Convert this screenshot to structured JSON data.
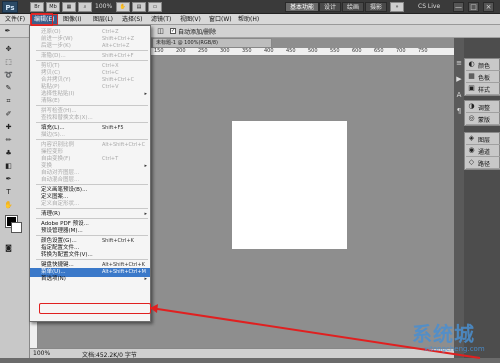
{
  "appbar": {
    "logo": "Ps",
    "zoom": "100%",
    "workspaces": [
      "基本功能",
      "设计",
      "绘画",
      "摄影"
    ],
    "cs_live": "CS Live",
    "window_controls": [
      "—",
      "□",
      "×"
    ]
  },
  "menubar": {
    "items": [
      "文件(F)",
      "编辑(E)",
      "图像(I)",
      "图层(L)",
      "选择(S)",
      "滤镜(T)",
      "视图(V)",
      "窗口(W)",
      "帮助(H)"
    ],
    "selected_index": 1
  },
  "options": {
    "auto_add_delete": "自动添加/删除"
  },
  "edit_menu": [
    {
      "label": "还原(O)",
      "shortcut": "Ctrl+Z",
      "disabled": true
    },
    {
      "label": "前进一步(W)",
      "shortcut": "Shift+Ctrl+Z",
      "disabled": true
    },
    {
      "label": "后退一步(K)",
      "shortcut": "Alt+Ctrl+Z",
      "disabled": true
    },
    {
      "sep": true
    },
    {
      "label": "渐隐(D)...",
      "shortcut": "Shift+Ctrl+F",
      "disabled": true
    },
    {
      "sep": true
    },
    {
      "label": "剪切(T)",
      "shortcut": "Ctrl+X",
      "disabled": true
    },
    {
      "label": "拷贝(C)",
      "shortcut": "Ctrl+C",
      "disabled": true
    },
    {
      "label": "合并拷贝(Y)",
      "shortcut": "Shift+Ctrl+C",
      "disabled": true
    },
    {
      "label": "粘贴(P)",
      "shortcut": "Ctrl+V",
      "disabled": true
    },
    {
      "label": "选择性粘贴(I)",
      "shortcut": "",
      "disabled": true,
      "submenu": true
    },
    {
      "label": "清除(E)",
      "shortcut": "",
      "disabled": true
    },
    {
      "sep": true
    },
    {
      "label": "拼写检查(H)...",
      "shortcut": "",
      "disabled": true
    },
    {
      "label": "查找和替换文本(X)...",
      "shortcut": "",
      "disabled": true
    },
    {
      "sep": true
    },
    {
      "label": "填充(L)...",
      "shortcut": "Shift+F5",
      "disabled": false
    },
    {
      "label": "描边(S)...",
      "shortcut": "",
      "disabled": true
    },
    {
      "sep": true
    },
    {
      "label": "内容识别比例",
      "shortcut": "Alt+Shift+Ctrl+C",
      "disabled": true
    },
    {
      "label": "操控变形",
      "shortcut": "",
      "disabled": true
    },
    {
      "label": "自由变换(F)",
      "shortcut": "Ctrl+T",
      "disabled": true
    },
    {
      "label": "变换",
      "shortcut": "",
      "disabled": true,
      "submenu": true
    },
    {
      "label": "自动对齐图层...",
      "shortcut": "",
      "disabled": true
    },
    {
      "label": "自动混合图层...",
      "shortcut": "",
      "disabled": true
    },
    {
      "sep": true
    },
    {
      "label": "定义画笔预设(B)...",
      "shortcut": "",
      "disabled": false
    },
    {
      "label": "定义图案...",
      "shortcut": "",
      "disabled": false
    },
    {
      "label": "定义自定形状...",
      "shortcut": "",
      "disabled": true
    },
    {
      "sep": true
    },
    {
      "label": "清理(R)",
      "shortcut": "",
      "disabled": false,
      "submenu": true
    },
    {
      "sep": true
    },
    {
      "label": "Adobe PDF 预设...",
      "shortcut": "",
      "disabled": false
    },
    {
      "label": "预设管理器(M)...",
      "shortcut": "",
      "disabled": false
    },
    {
      "sep": true
    },
    {
      "label": "颜色设置(G)...",
      "shortcut": "Shift+Ctrl+K",
      "disabled": false
    },
    {
      "label": "指定配置文件...",
      "shortcut": "",
      "disabled": false
    },
    {
      "label": "转换为配置文件(V)...",
      "shortcut": "",
      "disabled": false
    },
    {
      "sep": true
    },
    {
      "label": "键盘快捷键...",
      "shortcut": "Alt+Shift+Ctrl+K",
      "disabled": false
    },
    {
      "label": "菜单(U)...",
      "shortcut": "Alt+Shift+Ctrl+M",
      "disabled": false,
      "highlighted": true
    },
    {
      "label": "首选项(N)",
      "shortcut": "",
      "disabled": false,
      "submenu": true
    }
  ],
  "document": {
    "tab": "未标题-1 @ 100%(RGB/8)",
    "ruler_ticks": [
      "150",
      "200",
      "250",
      "300",
      "350",
      "400",
      "450",
      "500",
      "550",
      "600",
      "650",
      "700",
      "750"
    ]
  },
  "status": {
    "zoom": "100%",
    "doc_info": "文档:452.2K/0 字节"
  },
  "panels": [
    {
      "label": "颜色",
      "icon": "palette-icon"
    },
    {
      "label": "色板",
      "icon": "swatches-icon"
    },
    {
      "label": "样式",
      "icon": "styles-icon"
    },
    {
      "label": "调整",
      "icon": "adjust-icon"
    },
    {
      "label": "蒙版",
      "icon": "mask-icon"
    },
    {
      "label": "图层",
      "icon": "layers-icon"
    },
    {
      "label": "通道",
      "icon": "channels-icon"
    },
    {
      "label": "路径",
      "icon": "paths-icon"
    }
  ],
  "watermark": {
    "brand": "系统城",
    "url": "xitongcheng.com"
  },
  "colors": {
    "menu_highlight": "#3b79c9",
    "annotation_red": "#e02020"
  }
}
